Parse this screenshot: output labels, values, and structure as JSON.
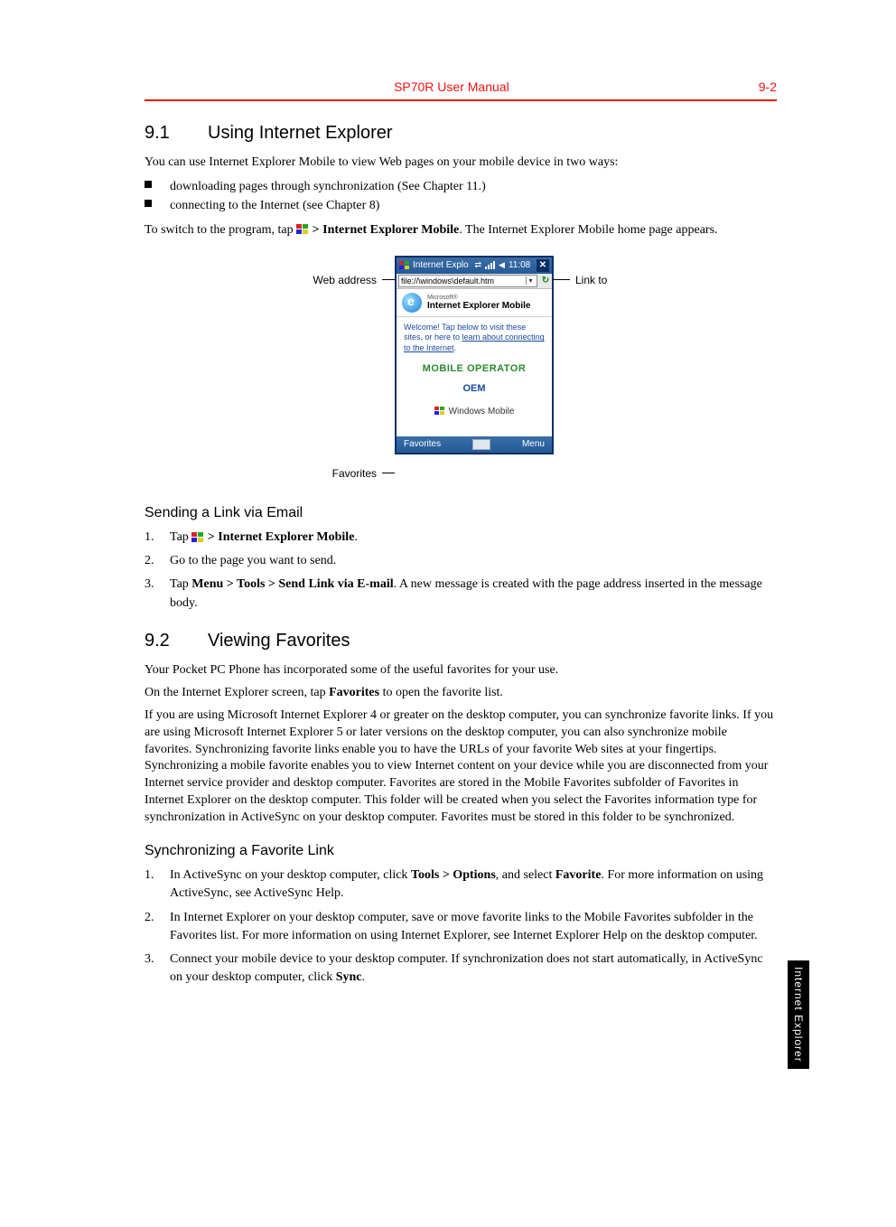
{
  "header": {
    "title": "SP70R User Manual",
    "page": "9-2"
  },
  "side_tab": "Internet Explorer",
  "sec91": {
    "num": "9.1",
    "title": "Using Internet Explorer",
    "intro": "You can use Internet Explorer Mobile to view Web pages on your mobile device in two ways:",
    "bullets": [
      "downloading pages through synchronization (See Chapter 11.)",
      "connecting to the Internet (see Chapter 8)"
    ],
    "switch_pre": "To switch to the program, tap ",
    "switch_bold": "> Internet Explorer Mobile",
    "switch_post": ". The Internet Explorer Mobile home page appears."
  },
  "fig": {
    "label_left_addr": "Web address",
    "label_left_fav": "Favorites",
    "label_right_link": "Link to",
    "device": {
      "titlebar": "Internet Explo",
      "time": "11:08",
      "address": "file://\\windows\\default.htm",
      "brand_small": "Microsoft®",
      "brand_main": "Internet Explorer Mobile",
      "welcome_line": "Welcome! Tap below to visit these sites, or here to ",
      "welcome_link": "learn about connecting to the Internet",
      "welcome_end": ".",
      "mobile_operator": "MOBILE OPERATOR",
      "oem": "OEM",
      "windows_mobile": "Windows Mobile",
      "soft_left": "Favorites",
      "soft_right": "Menu"
    }
  },
  "sub_send": {
    "title": "Sending a Link via Email",
    "i1_pre": "Tap ",
    "i1_bold": "> Internet Explorer Mobile",
    "i1_post": ".",
    "i2": "Go to the page you want to send.",
    "i3_pre": "Tap ",
    "i3_bold": "Menu > Tools > Send Link via E-mail",
    "i3_post": ". A new message is created with the page address inserted in the message body."
  },
  "sec92": {
    "num": "9.2",
    "title": "Viewing Favorites",
    "p1": "Your Pocket PC Phone has incorporated some of the useful favorites for your use.",
    "p2_pre": "On the Internet Explorer screen, tap ",
    "p2_bold": "Favorites",
    "p2_post": " to open the favorite list.",
    "p3": "If you are using Microsoft Internet Explorer 4 or greater on the desktop computer, you can synchronize favorite links. If you are using Microsoft Internet Explorer 5 or later versions on the desktop computer, you can also synchronize mobile favorites. Synchronizing favorite links enable you to have the URLs of your favorite Web sites at your fingertips. Synchronizing a mobile favorite enables you to view Internet content on your device while you are disconnected from your Internet service provider and desktop computer. Favorites are stored in the Mobile Favorites subfolder of Favorites in Internet Explorer on the desktop computer. This folder will be created when you select the Favorites information type for synchronization in ActiveSync on your desktop computer. Favorites must be stored in this folder to be synchronized."
  },
  "sub_sync": {
    "title": "Synchronizing a Favorite Link",
    "i1_pre": "In ActiveSync on your desktop computer, click ",
    "i1_b1": "Tools > Options",
    "i1_mid": ", and select ",
    "i1_b2": "Favorite",
    "i1_post": ". For more information on using ActiveSync, see ActiveSync Help.",
    "i2": "In Internet Explorer on your desktop computer, save or move favorite links to the Mobile Favorites subfolder in the Favorites list. For more information on using Internet Explorer, see Internet Explorer Help on the desktop computer.",
    "i3_pre": "Connect your mobile device to your desktop computer. If synchronization does not start automatically, in ActiveSync on your desktop computer, click ",
    "i3_bold": "Sync",
    "i3_post": "."
  }
}
